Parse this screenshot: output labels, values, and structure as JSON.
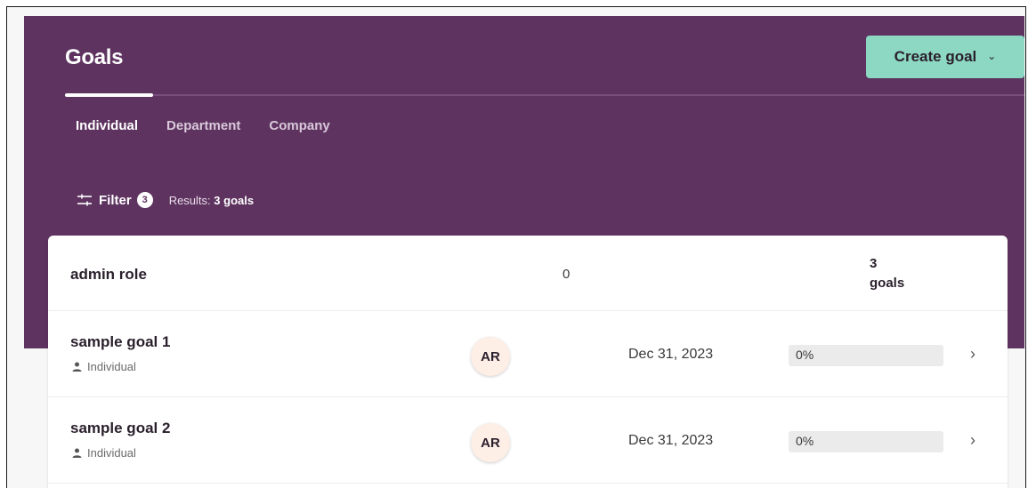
{
  "header": {
    "title": "Goals",
    "create_button_label": "Create goal",
    "create_button_chevron": "⌄"
  },
  "tabs": [
    {
      "label": "Individual",
      "active": true
    },
    {
      "label": "Department",
      "active": false
    },
    {
      "label": "Company",
      "active": false
    }
  ],
  "filter": {
    "label": "Filter",
    "count": "3",
    "results_prefix": "Results:",
    "results_value": "3 goals"
  },
  "group": {
    "name": "admin role",
    "zero": "0",
    "goals_count": "3",
    "goals_word": "goals"
  },
  "goals": [
    {
      "name": "sample goal 1",
      "type": "Individual",
      "owner_initials": "AR",
      "due_date": "Dec 31, 2023",
      "progress_text": "0%",
      "progress": 0
    },
    {
      "name": "sample goal 2",
      "type": "Individual",
      "owner_initials": "AR",
      "due_date": "Dec 31, 2023",
      "progress_text": "0%",
      "progress": 0
    }
  ],
  "colors": {
    "header_bg": "#5e3360",
    "accent": "#8dd8c2",
    "avatar_bg": "#fdeee6"
  },
  "icons": {
    "filter": "sliders-icon",
    "type": "person-icon",
    "row": "chevron-right-icon",
    "dropdown": "chevron-down-icon"
  }
}
